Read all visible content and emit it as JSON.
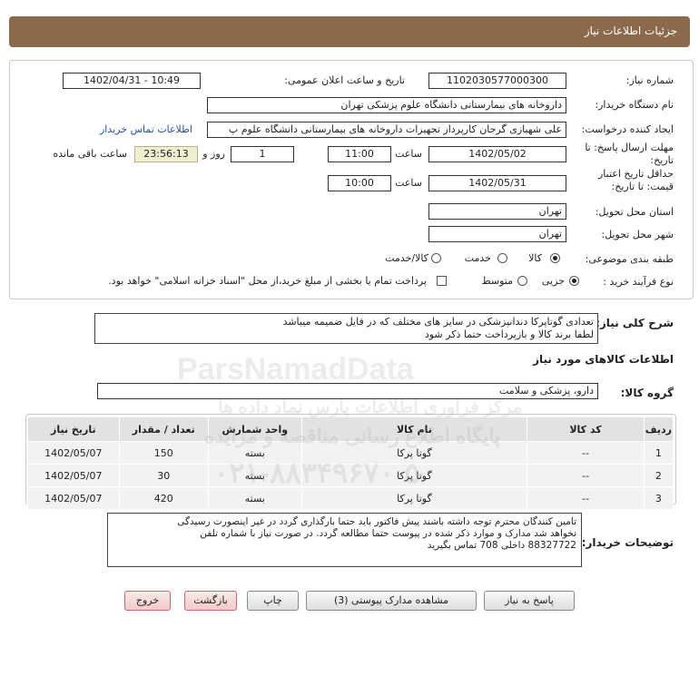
{
  "header": {
    "title": "جزئیات اطلاعات نیاز"
  },
  "form": {
    "need_number_label": "شماره نیاز:",
    "need_number": "1102030577000300",
    "announce_label": "تاریخ و ساعت اعلان عمومی:",
    "announce_value": "1402/04/31 - 10:49",
    "buyer_org_label": "نام دستگاه خریدار:",
    "buyer_org": "داروخانه های بیمارستانی دانشگاه علوم پزشکی تهران",
    "creator_label": "ایجاد کننده درخواست:",
    "creator": "علی شهبازی گرجان کارپرداز تجهیزات داروخانه های بیمارستانی دانشگاه علوم پ",
    "contact_link": "اطلاعات تماس خریدار",
    "deadline_label": "مهلت ارسال پاسخ: تا تاریخ:",
    "deadline_date": "1402/05/02",
    "time_label": "ساعت",
    "deadline_time": "11:00",
    "days_value": "1",
    "days_label": "روز و",
    "remaining_timer": "23:56:13",
    "remaining_label": "ساعت باقی مانده",
    "validity_label": "حداقل تاریخ اعتبار قیمت: تا تاریخ:",
    "validity_date": "1402/05/31",
    "validity_time": "10:00",
    "province_label": "استان محل تحویل:",
    "province": "تهران",
    "city_label": "شهر محل تحویل:",
    "city": "تهران",
    "category_label": "طبقه بندی موضوعی:",
    "category_options": [
      "کالا",
      "خدمت",
      "کالا/خدمت"
    ],
    "category_selected": "کالا",
    "process_label": "نوع فرآیند خرید :",
    "process_options": [
      "جزیی",
      "متوسط"
    ],
    "process_selected": "جزیی",
    "payment_note": "پرداخت تمام یا بخشی از مبلغ خرید،از محل \"اسناد خزانه اسلامی\" خواهد بود."
  },
  "description": {
    "label": "شرح کلی نیاز:",
    "line1": "تعدادی گوتاپرکا دندانپزشکی در سایز های مختلف که در فایل ضمیمه میباشد",
    "line2": "لطفا برند کالا و بازپرداخت حتما ذکر شود"
  },
  "goods": {
    "section_title": "اطلاعات کالاهای مورد نیاز",
    "group_label": "گروه کالا:",
    "group_value": "دارو، پزشکی و سلامت",
    "columns": [
      "ردیف",
      "کد کالا",
      "نام کالا",
      "واحد شمارش",
      "تعداد / مقدار",
      "تاریخ نیاز"
    ],
    "rows": [
      {
        "row": "1",
        "code": "--",
        "name": "گوتا پرکا",
        "unit": "بسته",
        "qty": "150",
        "date": "1402/05/07"
      },
      {
        "row": "2",
        "code": "--",
        "name": "گوتا پرکا",
        "unit": "بسته",
        "qty": "30",
        "date": "1402/05/07"
      },
      {
        "row": "3",
        "code": "--",
        "name": "گوتا پرکا",
        "unit": "بسته",
        "qty": "420",
        "date": "1402/05/07"
      }
    ]
  },
  "buyer_notes": {
    "label": "توضیحات خریدار:",
    "line1": "تامین کنندگان محترم توجه داشته باشند پیش فاکتور باید حتما بارگذاری گردد در غیر اینصورت رسیدگی",
    "line2": "نخواهد شد مدارک و موارد ذکر شده در پیوست حتما مطالعه گردد. در صورت نیاز با شماره تلفن",
    "line3": "88327722 داخلی 708 تماس بگیرید"
  },
  "buttons": {
    "reply": "پاسخ به نیاز",
    "attachments": "مشاهده مدارک پیوستی (3)",
    "print": "چاپ",
    "back": "بازگشت",
    "exit": "خروج"
  },
  "watermark": {
    "brand": "ParsNamadData",
    "persian": "مرکز فراوری اطلاعات پارس نماد داده ها",
    "portal": "پایگاه اطلاع رسانی مناقصه و مزایده",
    "phone": "۰۲۱-۸۸۳۴۹۶۷۰-۵"
  }
}
